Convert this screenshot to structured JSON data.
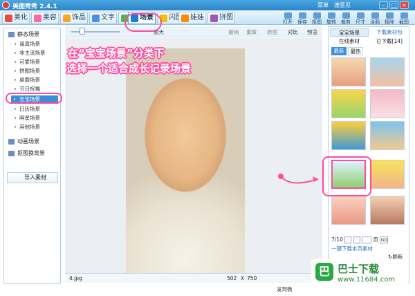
{
  "window": {
    "title": "美图秀秀 2.4.1",
    "menu": [
      "菜单",
      "搜意见"
    ],
    "controls": {
      "minimize": "–",
      "maximize": "□",
      "close": "×"
    }
  },
  "toolbar": {
    "tabs": [
      {
        "label": "美化",
        "icon": "beautify-icon",
        "color": "#e94b3c"
      },
      {
        "label": "美容",
        "icon": "makeup-icon",
        "color": "#ff6aa2"
      },
      {
        "label": "饰品",
        "icon": "accessory-icon",
        "color": "#f5a623"
      },
      {
        "label": "文字",
        "icon": "text-icon",
        "color": "#4a90e2"
      },
      {
        "label": "边框",
        "icon": "frame-icon",
        "color": "#50b848"
      },
      {
        "label": "场景",
        "icon": "scene-icon",
        "color": "#1f7ad2"
      },
      {
        "label": "闪图",
        "icon": "flash-icon",
        "color": "#f5c000"
      },
      {
        "label": "娃娃",
        "icon": "doll-icon",
        "color": "#ff8a00"
      },
      {
        "label": "拼图",
        "icon": "puzzle-icon",
        "color": "#9b59b6"
      }
    ],
    "tools": [
      "打开",
      "保存",
      "抠图",
      "旋转",
      "裁剪",
      "尺寸",
      "涂鸦",
      "抠除",
      "截图"
    ]
  },
  "left_panel": {
    "categories": [
      {
        "label": "静态场景",
        "icon": "static-scene-icon"
      },
      {
        "label": "动画场景",
        "icon": "animated-scene-icon"
      },
      {
        "label": "抠图换背景",
        "icon": "cutout-background-icon"
      }
    ],
    "static_items": [
      "逼真场景",
      "非主流场景",
      "可爱场景",
      "拼图场景",
      "桌面场景",
      "节日祝福",
      "宝宝场景",
      "日历场景",
      "明星场景",
      "其他场景"
    ],
    "import_label": "导入素材"
  },
  "canvas": {
    "toolbar": {
      "zoom_label": "原大",
      "undo": "撤销",
      "redo": "重做",
      "reset": "原图",
      "compare": "对比",
      "preview": "预览"
    },
    "status": {
      "filename": "4.jpg",
      "width": "502",
      "sep": "X",
      "height": "750"
    }
  },
  "right_panel": {
    "header_tab": "宝宝场景",
    "download_tab": "下载素材包",
    "sub_tabs": [
      "在线素材",
      "已下载[14]"
    ],
    "sort_tabs": [
      "最新",
      "最热"
    ],
    "pager": {
      "current": "7/10",
      "page_suffix": "页",
      "go": "GO"
    },
    "download_all": "一键下载本页素材",
    "refresh": "刷新"
  },
  "annotation": {
    "line1": "在“宝宝场景”分类下",
    "line2": "选择一个适合成长记录场景"
  },
  "watermark": {
    "logo_char": "巴",
    "title": "巴士下载",
    "url": "www.11684.com"
  },
  "footer": {
    "feedback": "发到微"
  }
}
